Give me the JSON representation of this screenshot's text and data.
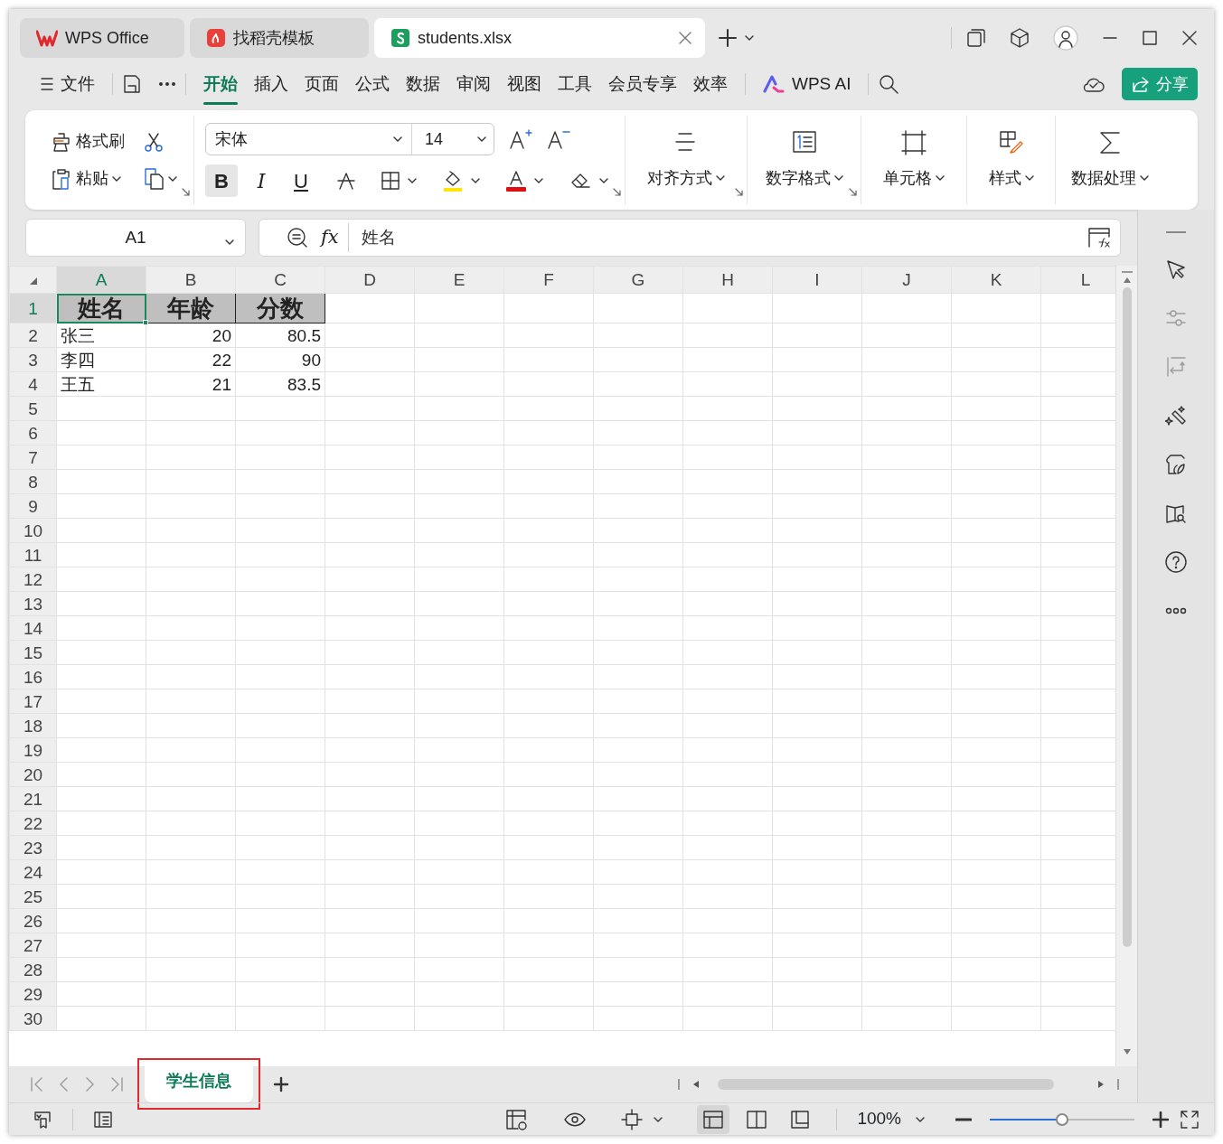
{
  "window": {
    "tabs": [
      {
        "label": "WPS Office",
        "kind": "wps",
        "selected": false
      },
      {
        "label": "找稻壳模板",
        "kind": "template",
        "selected": false
      },
      {
        "label": "students.xlsx",
        "kind": "sheet",
        "selected": true
      }
    ]
  },
  "menu": {
    "file": "文件",
    "items": [
      {
        "label": "开始",
        "selected": true
      },
      {
        "label": "插入",
        "selected": false
      },
      {
        "label": "页面",
        "selected": false
      },
      {
        "label": "公式",
        "selected": false
      },
      {
        "label": "数据",
        "selected": false
      },
      {
        "label": "审阅",
        "selected": false
      },
      {
        "label": "视图",
        "selected": false
      },
      {
        "label": "工具",
        "selected": false
      },
      {
        "label": "会员专享",
        "selected": false
      },
      {
        "label": "效率",
        "selected": false
      }
    ],
    "ai": "WPS AI",
    "share": "分享"
  },
  "ribbon": {
    "format_painter": "格式刷",
    "paste": "粘贴",
    "font": "宋体",
    "font_size": "14",
    "styles": [
      {
        "label": "B",
        "kind": "bold",
        "selected": true
      },
      {
        "label": "I",
        "kind": "italic",
        "selected": false
      },
      {
        "label": "U",
        "kind": "underline",
        "selected": false
      }
    ],
    "groups": [
      {
        "label": "对齐方式",
        "kind": "align"
      },
      {
        "label": "数字格式",
        "kind": "number"
      },
      {
        "label": "单元格",
        "kind": "cell"
      },
      {
        "label": "样式",
        "kind": "style"
      },
      {
        "label": "数据处理",
        "kind": "sum"
      }
    ]
  },
  "formula_bar": {
    "name_box": "A1",
    "function_label": "fx",
    "value": "姓名"
  },
  "sheet": {
    "columns": [
      {
        "letter": "A",
        "selected": true
      },
      {
        "letter": "B",
        "selected": false
      },
      {
        "letter": "C",
        "selected": false
      },
      {
        "letter": "D",
        "selected": false
      },
      {
        "letter": "E",
        "selected": false
      },
      {
        "letter": "F",
        "selected": false
      },
      {
        "letter": "G",
        "selected": false
      },
      {
        "letter": "H",
        "selected": false
      },
      {
        "letter": "I",
        "selected": false
      },
      {
        "letter": "J",
        "selected": false
      },
      {
        "letter": "K",
        "selected": false
      },
      {
        "letter": "L",
        "selected": false
      }
    ],
    "rows": [
      {
        "number": "1",
        "selected": true,
        "kind": "header",
        "cells": [
          {
            "text": "姓名"
          },
          {
            "text": "年龄"
          },
          {
            "text": "分数"
          }
        ]
      },
      {
        "number": "2",
        "selected": false,
        "kind": "data",
        "cells": [
          {
            "text": "张三",
            "kind": "text"
          },
          {
            "text": "20",
            "kind": "number"
          },
          {
            "text": "80.5",
            "kind": "number"
          }
        ]
      },
      {
        "number": "3",
        "selected": false,
        "kind": "data",
        "cells": [
          {
            "text": "李四",
            "kind": "text"
          },
          {
            "text": "22",
            "kind": "number"
          },
          {
            "text": "90",
            "kind": "number"
          }
        ]
      },
      {
        "number": "4",
        "selected": false,
        "kind": "data",
        "cells": [
          {
            "text": "王五",
            "kind": "text"
          },
          {
            "text": "21",
            "kind": "number"
          },
          {
            "text": "83.5",
            "kind": "number"
          }
        ]
      },
      {
        "number": "5",
        "selected": false
      },
      {
        "number": "6",
        "selected": false
      },
      {
        "number": "7",
        "selected": false
      },
      {
        "number": "8",
        "selected": false
      },
      {
        "number": "9",
        "selected": false
      },
      {
        "number": "10",
        "selected": false
      },
      {
        "number": "11",
        "selected": false
      },
      {
        "number": "12",
        "selected": false
      },
      {
        "number": "13",
        "selected": false
      },
      {
        "number": "14",
        "selected": false
      },
      {
        "number": "15",
        "selected": false
      },
      {
        "number": "16",
        "selected": false
      },
      {
        "number": "17",
        "selected": false
      },
      {
        "number": "18",
        "selected": false
      },
      {
        "number": "19",
        "selected": false
      },
      {
        "number": "20",
        "selected": false
      },
      {
        "number": "21",
        "selected": false
      },
      {
        "number": "22",
        "selected": false
      },
      {
        "number": "23",
        "selected": false
      },
      {
        "number": "24",
        "selected": false
      },
      {
        "number": "25",
        "selected": false
      },
      {
        "number": "26",
        "selected": false
      },
      {
        "number": "27",
        "selected": false
      },
      {
        "number": "28",
        "selected": false
      },
      {
        "number": "29",
        "selected": false
      },
      {
        "number": "30",
        "selected": false
      }
    ]
  },
  "side_tools": [
    {
      "kind": "cursor",
      "disabled": false
    },
    {
      "kind": "sliders",
      "disabled": true
    },
    {
      "kind": "return",
      "disabled": true
    },
    {
      "kind": "wand",
      "disabled": false
    },
    {
      "kind": "shop",
      "disabled": false
    },
    {
      "kind": "book",
      "disabled": false
    },
    {
      "kind": "help",
      "disabled": false
    },
    {
      "kind": "more",
      "disabled": false
    }
  ],
  "sheet_tabs": [
    {
      "label": "学生信息",
      "selected": true
    }
  ],
  "status_bar": {
    "views": [
      {
        "kind": "normal",
        "selected": true
      },
      {
        "kind": "split",
        "selected": false
      },
      {
        "kind": "page",
        "selected": false
      }
    ],
    "zoom": "100%",
    "zoom_slider": {
      "level": 0.5
    }
  }
}
